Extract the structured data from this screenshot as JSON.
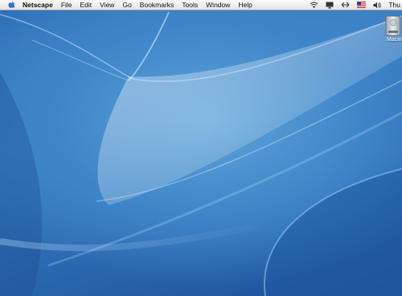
{
  "menubar": {
    "apple_icon": "apple-icon",
    "app_name": "Netscape",
    "items": [
      "File",
      "Edit",
      "View",
      "Go",
      "Bookmarks",
      "Tools",
      "Window",
      "Help"
    ],
    "status_icons": [
      "airport-icon",
      "display-icon",
      "sync-icon",
      "us-flag-icon",
      "volume-icon"
    ],
    "clock": "Thu"
  },
  "desktop": {
    "volume_label": "Macin",
    "volume_icon": "hard-drive-icon",
    "colors": {
      "wallpaper_light": "#6aaee0",
      "wallpaper_dark": "#1d4f97"
    }
  }
}
